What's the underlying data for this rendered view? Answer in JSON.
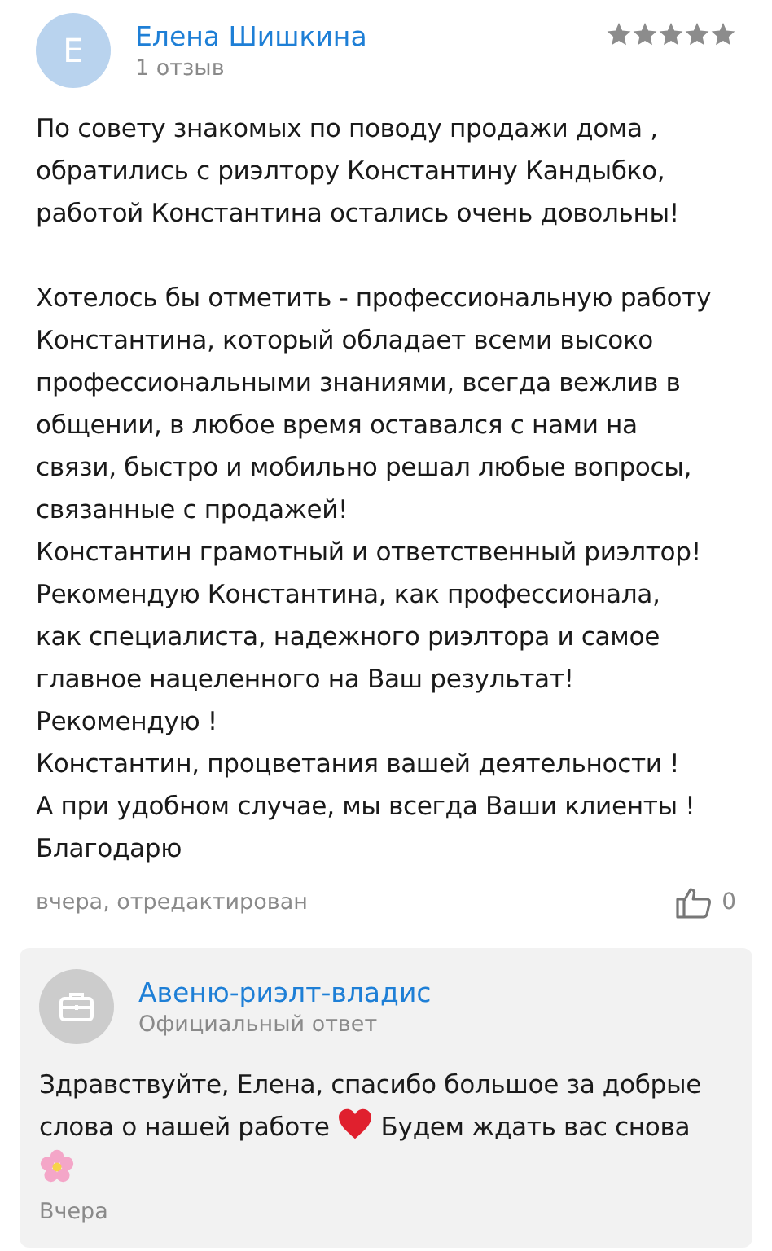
{
  "review": {
    "author": {
      "initial": "Е",
      "name": "Елена Шишкина",
      "reviews_count": "1 отзыв"
    },
    "stars": 5,
    "paragraphs": [
      "По совету знакомых по поводу продажи дома ,\nобратились с риэлтору Константину Кандыбко,\nработой Константина остались очень довольны!",
      "Хотелось бы отметить - профессиональную работу\nКонстантина, который обладает всеми высоко\nпрофессиональными знаниями, всегда вежлив в\nобщении, в любое время оставался с нами на\nсвязи, быстро и мобильно решал любые вопросы,\nсвязанные с продажей!\nКонстантин грамотный и ответственный риэлтор!\nРекомендую Константина, как профессионала,\nкак специалиста, надежного риэлтора и самое\nглавное нацеленного на Ваш результат!\nРекомендую !\nКонстантин, процветания вашей деятельности !\nА при удобном случае, мы всегда Ваши клиенты !\nБлагодарю"
    ],
    "date": "вчера, отредактирован",
    "likes": "0"
  },
  "reply": {
    "author": "Авеню-риэлт-владис",
    "label": "Официальный ответ",
    "text_parts": [
      {
        "kind": "text",
        "text": "Здравствуйте, Елена, спасибо большое за добрые\nслова о нашей работе "
      },
      {
        "kind": "heart"
      },
      {
        "kind": "text",
        "text": " Будем ждать вас снова\n"
      },
      {
        "kind": "flower"
      }
    ],
    "date": "Вчера"
  }
}
